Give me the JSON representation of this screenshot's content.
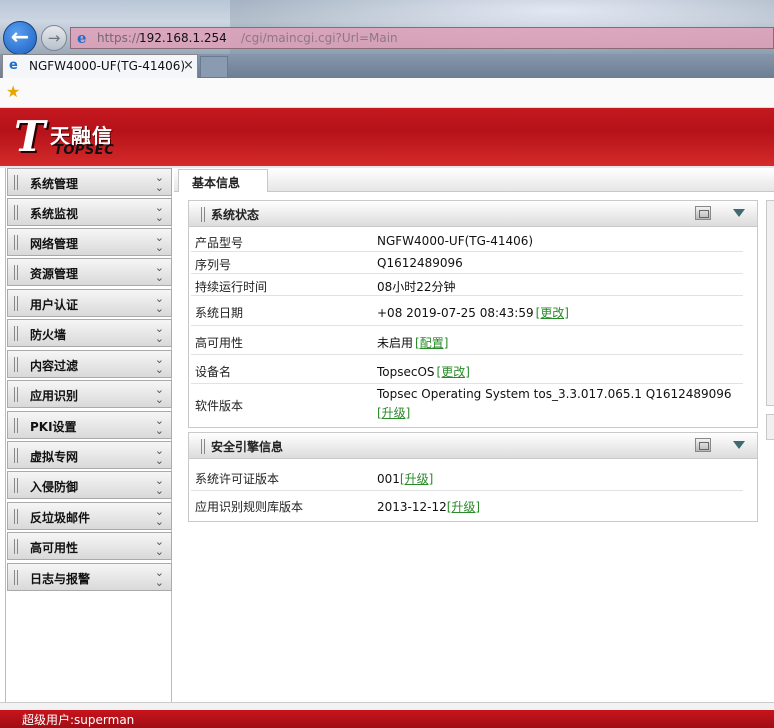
{
  "browser": {
    "url_prefix": "https://",
    "url_host": "192.168.1.254",
    "url_rest": "/cgi/maincgi.cgi?Url=Main",
    "tab_title": "NGFW4000-UF(TG-41406)",
    "tab_close": "×"
  },
  "brand": {
    "logo_mark": "T",
    "name_cn": "天融信",
    "name_en": "TOPSEC"
  },
  "sidebar": {
    "items": [
      {
        "label": "系统管理"
      },
      {
        "label": "系统监视"
      },
      {
        "label": "网络管理"
      },
      {
        "label": "资源管理"
      },
      {
        "label": "用户认证"
      },
      {
        "label": "防火墙"
      },
      {
        "label": "内容过滤"
      },
      {
        "label": "应用识别"
      },
      {
        "label": "PKI设置"
      },
      {
        "label": "虚拟专网"
      },
      {
        "label": "入侵防御"
      },
      {
        "label": "反垃圾邮件"
      },
      {
        "label": "高可用性"
      },
      {
        "label": "日志与报警"
      }
    ]
  },
  "content": {
    "tab_label": "基本信息"
  },
  "system_status": {
    "title": "系统状态",
    "rows": {
      "model": {
        "key": "产品型号",
        "value": "NGFW4000-UF(TG-41406)"
      },
      "serial": {
        "key": "序列号",
        "value": "Q1612489096"
      },
      "uptime": {
        "key": "持续运行时间",
        "value": "08小时22分钟"
      },
      "date": {
        "key": "系统日期",
        "value": "+08 2019-07-25 08:43:59",
        "link": "[更改]"
      },
      "ha": {
        "key": "高可用性",
        "value": "未启用",
        "link": "[配置]"
      },
      "device": {
        "key": "设备名",
        "value": "TopsecOS",
        "link": "[更改]"
      },
      "software": {
        "key": "软件版本",
        "value": "Topsec Operating System tos_3.3.017.065.1 Q1612489096",
        "link": "[升级]"
      }
    }
  },
  "security_engine": {
    "title": "安全引擎信息",
    "rows": {
      "license": {
        "key": "系统许可证版本",
        "value": "001",
        "link": "[升级]"
      },
      "app_rules": {
        "key": "应用识别规则库版本",
        "value": "2013-12-12",
        "link": "[升级]"
      }
    }
  },
  "footer": {
    "user": "超级用户:superman"
  },
  "colors": {
    "brand_red": "#c5181f",
    "link_green": "#2a8a2a"
  },
  "icons": [
    "back-arrow-icon",
    "forward-arrow-icon",
    "ie-icon",
    "favorites-star-icon",
    "grip-icon",
    "double-chevron-down-icon",
    "maximize-icon",
    "collapse-triangle-icon"
  ]
}
